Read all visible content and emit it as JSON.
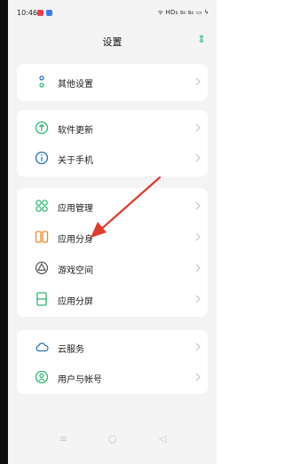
{
  "status_bar": {
    "time": "10:46",
    "right_indicators": "ᯤ HD₆ ᵴᵢₗ ᵴᵢₗ ▭ ϟ"
  },
  "header": {
    "title": "设置"
  },
  "groups": [
    {
      "items": [
        {
          "label": "其他设置",
          "icon": "dots-icon"
        }
      ]
    },
    {
      "items": [
        {
          "label": "软件更新",
          "icon": "update-icon"
        },
        {
          "label": "关于手机",
          "icon": "info-icon"
        }
      ]
    },
    {
      "items": [
        {
          "label": "应用管理",
          "icon": "grid-icon"
        },
        {
          "label": "应用分身",
          "icon": "clone-icon"
        },
        {
          "label": "游戏空间",
          "icon": "game-icon"
        },
        {
          "label": "应用分屏",
          "icon": "split-screen-icon"
        }
      ]
    },
    {
      "items": [
        {
          "label": "云服务",
          "icon": "cloud-icon"
        },
        {
          "label": "用户与帐号",
          "icon": "user-icon"
        }
      ]
    }
  ],
  "navbar": {
    "menu": "≡",
    "home": "○",
    "back": "◁"
  },
  "colors": {
    "accent_green": "#2bb673",
    "orange": "#f08a2e",
    "annotation_red": "#e23a2e"
  }
}
